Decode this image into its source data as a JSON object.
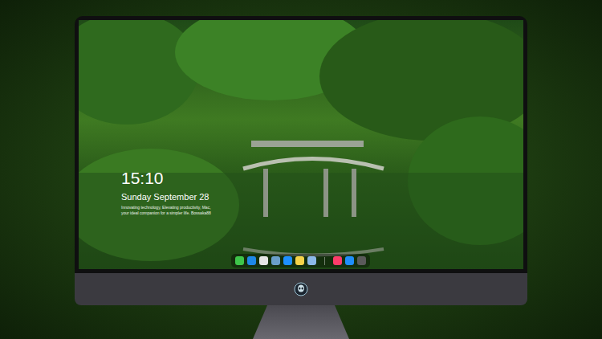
{
  "lock_screen": {
    "time": "15:10",
    "date": "Sunday September 28",
    "tagline": "Innovating technology, Elevating productivity, Mac, your ideal companion for a simpler life. Bossaka88"
  },
  "dock": {
    "items": [
      {
        "color": "#3ec54a"
      },
      {
        "color": "#1e88e5"
      },
      {
        "color": "#e5e5e5"
      },
      {
        "color": "#6a9ec9"
      },
      {
        "color": "#1e90ff"
      },
      {
        "color": "#f6d34a"
      },
      {
        "color": "#8bb8e8"
      },
      {
        "color": "#fc3c6a"
      },
      {
        "color": "#1f8efa"
      },
      {
        "color": "#5a5a5a"
      }
    ]
  }
}
